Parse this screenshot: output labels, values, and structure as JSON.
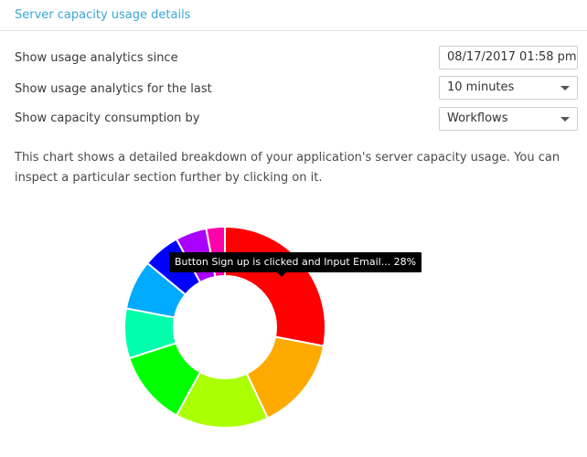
{
  "header": {
    "title": "Server capacity usage details"
  },
  "controls": [
    {
      "label": "Show usage analytics since",
      "value": "08/17/2017 01:58 pm",
      "type": "date"
    },
    {
      "label": "Show usage analytics for the last",
      "value": "10 minutes",
      "type": "select"
    },
    {
      "label": "Show capacity consumption by",
      "value": "Workflows",
      "type": "select"
    }
  ],
  "description": "This chart shows a detailed breakdown of your application's server capacity usage. You can inspect a particular section further by clicking on it.",
  "tooltip": {
    "text": "Button Sign up is clicked and Input Email... 28%"
  },
  "chart_data": {
    "type": "pie",
    "variant": "donut",
    "values": [
      28,
      15,
      15,
      12,
      8,
      8,
      6,
      5,
      3
    ],
    "colors": [
      "#ff0000",
      "#ffaa00",
      "#aaff00",
      "#00ff00",
      "#00ffaa",
      "#00aaff",
      "#0000ff",
      "#aa00ff",
      "#ff00aa"
    ]
  }
}
